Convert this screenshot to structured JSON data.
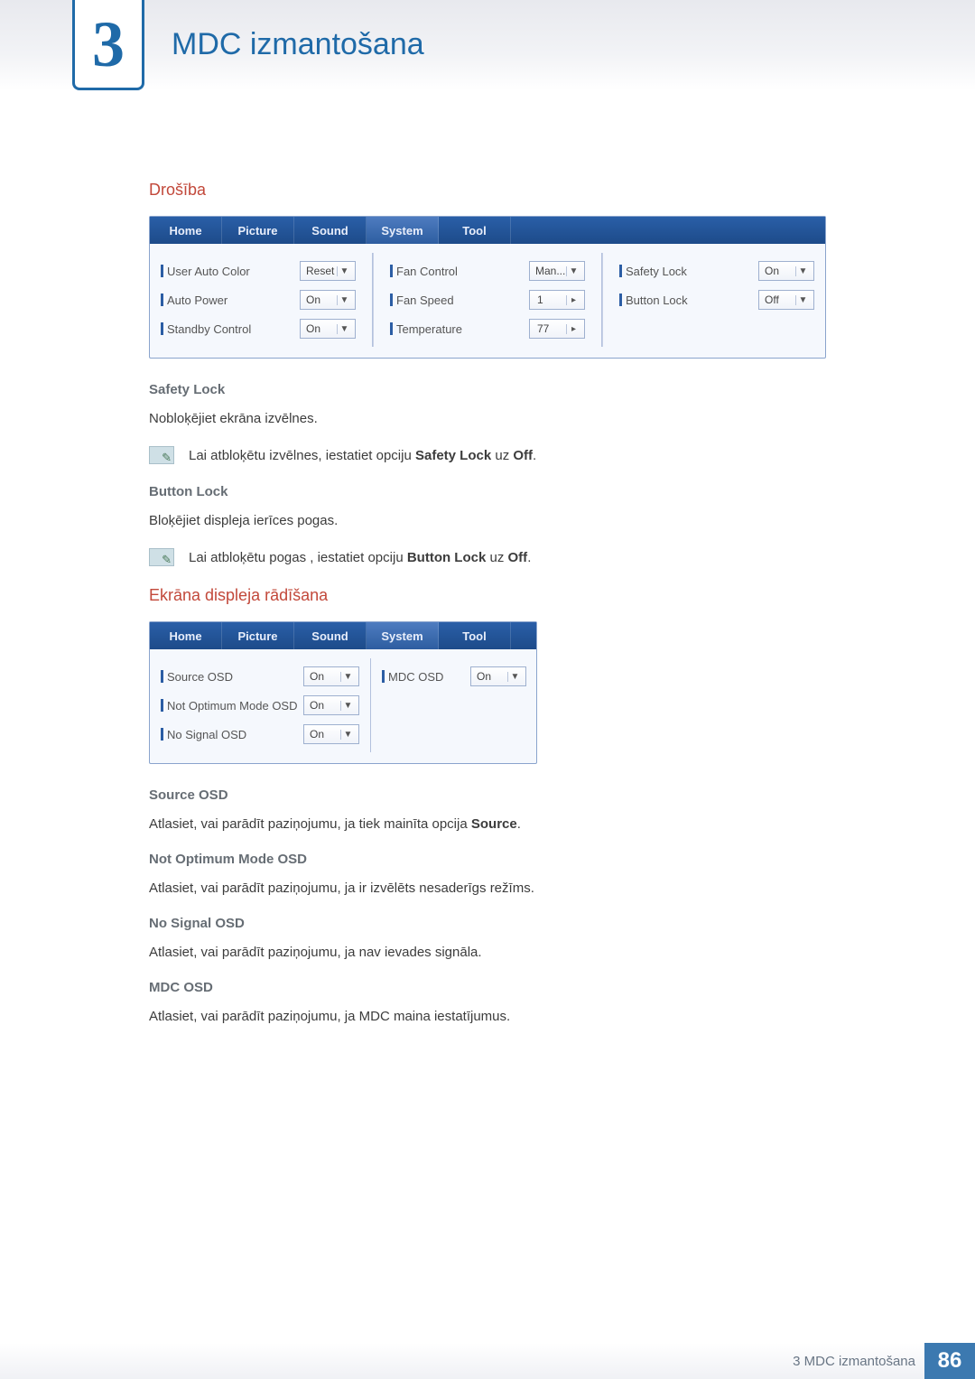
{
  "chapter": {
    "number": "3",
    "title": "MDC izmantošana"
  },
  "security": {
    "heading": "Drošība",
    "tabs": [
      "Home",
      "Picture",
      "Sound",
      "System",
      "Tool"
    ],
    "active_tab": 3,
    "col1": [
      {
        "label": "User Auto Color",
        "value": "Reset",
        "control": "dd"
      },
      {
        "label": "Auto Power",
        "value": "On",
        "control": "dd"
      },
      {
        "label": "Standby Control",
        "value": "On",
        "control": "dd"
      }
    ],
    "col2": [
      {
        "label": "Fan Control",
        "value": "Man...",
        "control": "dd"
      },
      {
        "label": "Fan Speed",
        "value": "1",
        "control": "spin"
      },
      {
        "label": "Temperature",
        "value": "77",
        "control": "spin"
      }
    ],
    "col3": [
      {
        "label": "Safety Lock",
        "value": "On",
        "control": "dd"
      },
      {
        "label": "Button Lock",
        "value": "Off",
        "control": "dd"
      }
    ],
    "safety_lock": {
      "heading": "Safety Lock",
      "text": "Nobloķējiet ekrāna izvēlnes.",
      "note_pre": "Lai atbloķētu izvēlnes, iestatiet opciju ",
      "note_b1": "Safety Lock",
      "note_mid": " uz ",
      "note_b2": "Off",
      "note_post": "."
    },
    "button_lock": {
      "heading": "Button Lock",
      "text": "Bloķējiet displeja ierīces pogas.",
      "note_pre": "Lai atbloķētu pogas , iestatiet opciju ",
      "note_b1": "Button Lock",
      "note_mid": " uz ",
      "note_b2": "Off",
      "note_post": "."
    }
  },
  "osd": {
    "heading": "Ekrāna displeja rādīšana",
    "tabs": [
      "Home",
      "Picture",
      "Sound",
      "System",
      "Tool"
    ],
    "active_tab": 3,
    "left": [
      {
        "label": "Source OSD",
        "value": "On"
      },
      {
        "label": "Not Optimum Mode OSD",
        "value": "On"
      },
      {
        "label": "No Signal OSD",
        "value": "On"
      }
    ],
    "right": [
      {
        "label": "MDC OSD",
        "value": "On"
      }
    ],
    "items": [
      {
        "heading": "Source OSD",
        "text_pre": "Atlasiet, vai parādīt paziņojumu, ja tiek mainīta opcija ",
        "bold": "Source",
        "text_post": "."
      },
      {
        "heading": "Not Optimum Mode OSD",
        "text": "Atlasiet, vai parādīt paziņojumu, ja ir izvēlēts nesaderīgs režīms."
      },
      {
        "heading": "No Signal OSD",
        "text": "Atlasiet, vai parādīt paziņojumu, ja nav ievades signāla."
      },
      {
        "heading": "MDC OSD",
        "text": "Atlasiet, vai parādīt paziņojumu, ja MDC maina iestatījumus."
      }
    ]
  },
  "footer": {
    "label": "3 MDC izmantošana",
    "page": "86"
  }
}
